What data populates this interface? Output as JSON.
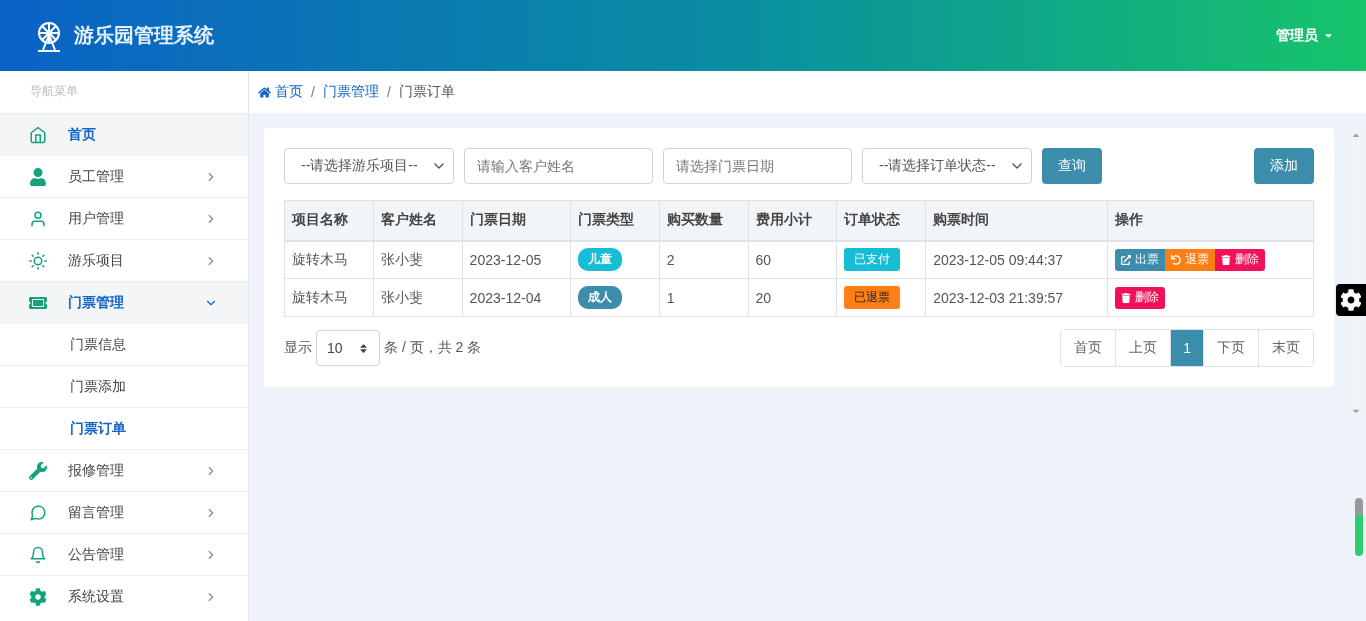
{
  "header": {
    "title": "游乐园管理系统",
    "user": "管理员"
  },
  "sidebar": {
    "heading": "导航菜单",
    "items": [
      {
        "label": "首页",
        "selected": true
      },
      {
        "label": "员工管理",
        "selected": false,
        "expanded": false
      },
      {
        "label": "用户管理",
        "selected": false,
        "expanded": false
      },
      {
        "label": "游乐项目",
        "selected": false,
        "expanded": false
      },
      {
        "label": "门票管理",
        "selected": true,
        "expanded": true,
        "children": [
          {
            "label": "门票信息",
            "selected": false
          },
          {
            "label": "门票添加",
            "selected": false
          },
          {
            "label": "门票订单",
            "selected": true
          }
        ]
      },
      {
        "label": "报修管理",
        "selected": false,
        "expanded": false
      },
      {
        "label": "留言管理",
        "selected": false,
        "expanded": false
      },
      {
        "label": "公告管理",
        "selected": false,
        "expanded": false
      },
      {
        "label": "系统设置",
        "selected": false,
        "expanded": false
      }
    ]
  },
  "breadcrumb": {
    "separator": "/",
    "items": [
      "首页",
      "门票管理",
      "门票订单"
    ]
  },
  "filters": {
    "project": "--请选择游乐项目--",
    "customer_placeholder": "请输入客户姓名",
    "date_placeholder": "请选择门票日期",
    "status": "--请选择订单状态--",
    "search_button": "查询",
    "add_button": "添加"
  },
  "table": {
    "columns": [
      "项目名称",
      "客户姓名",
      "门票日期",
      "门票类型",
      "购买数量",
      "费用小计",
      "订单状态",
      "购票时间",
      "操作"
    ],
    "rows": [
      {
        "project": "旋转木马",
        "customer": "张小斐",
        "date": "2023-12-05",
        "type": {
          "label": "儿童",
          "color": "#17bdd6"
        },
        "quantity": "2",
        "subtotal": "60",
        "status": {
          "label": "已支付",
          "color": "#17bdd6"
        },
        "time": "2023-12-05 09:44:37",
        "actions": [
          {
            "kind": "issue",
            "label": "出票",
            "color": "#3c8dab"
          },
          {
            "kind": "refund",
            "label": "退票",
            "color": "#fd7e14"
          },
          {
            "kind": "delete",
            "label": "删除",
            "color": "#f0115a"
          }
        ]
      },
      {
        "project": "旋转木马",
        "customer": "张小斐",
        "date": "2023-12-04",
        "type": {
          "label": "成人",
          "color": "#3c8dab"
        },
        "quantity": "1",
        "subtotal": "20",
        "status": {
          "label": "已退票",
          "color": "#fd7e14"
        },
        "time": "2023-12-03 21:39:57",
        "actions": [
          {
            "kind": "delete",
            "label": "删除",
            "color": "#f0115a"
          }
        ]
      }
    ]
  },
  "footer": {
    "show": "显示",
    "page_size": "10",
    "summary": "条 / 页，共 2 条",
    "pages": [
      {
        "label": "首页",
        "selected": false
      },
      {
        "label": "上页",
        "selected": false
      },
      {
        "label": "1",
        "selected": true
      },
      {
        "label": "下页",
        "selected": false
      },
      {
        "label": "末页",
        "selected": false
      }
    ]
  }
}
